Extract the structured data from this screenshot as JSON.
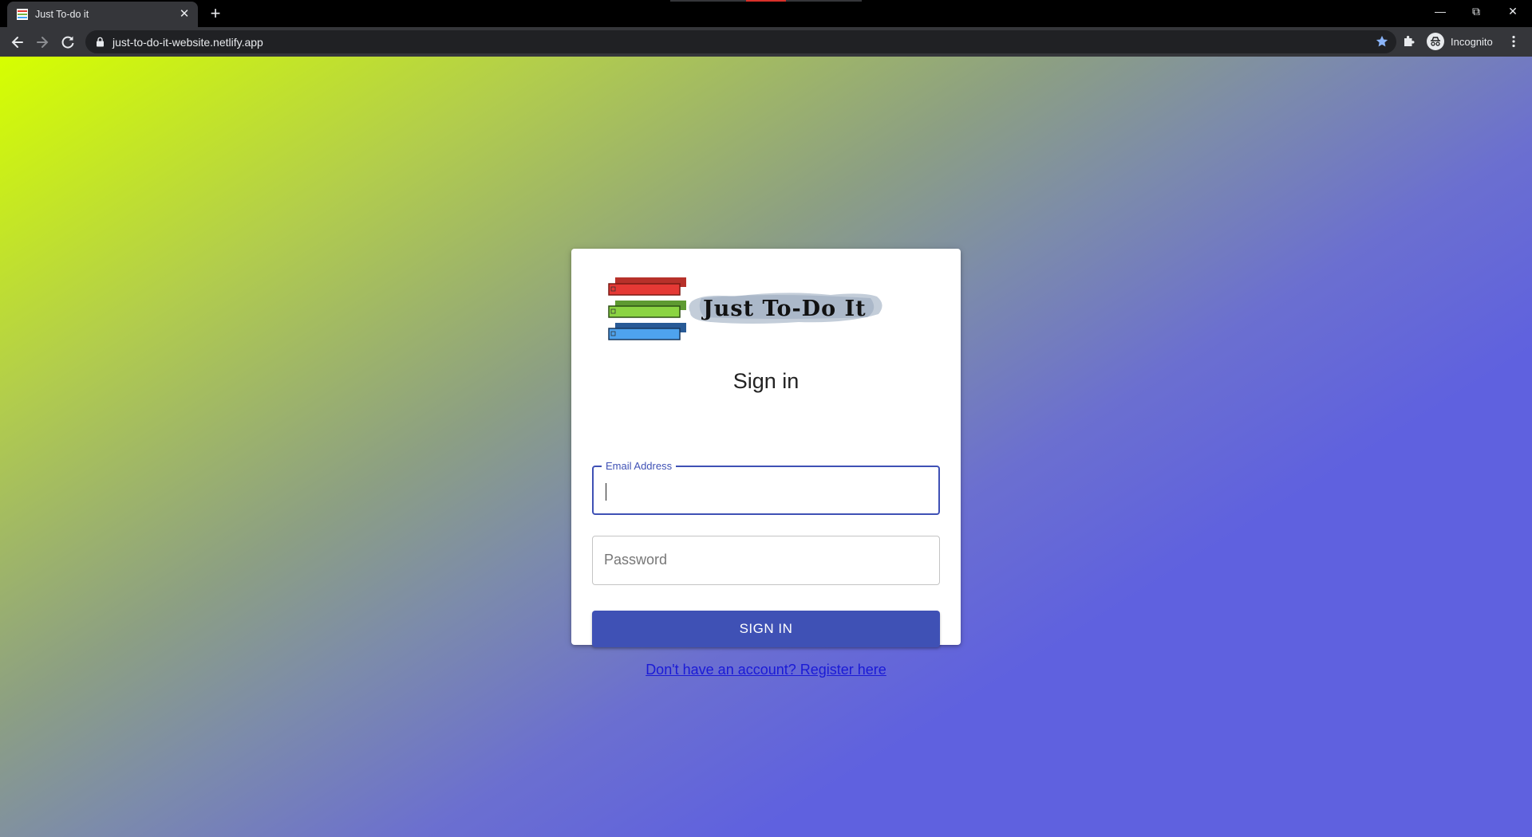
{
  "browser": {
    "tab_title": "Just To-do it",
    "url": "just-to-do-it-website.netlify.app",
    "profile_label": "Incognito",
    "accent_star": "#8ab4f8"
  },
  "icons": {
    "favicon": "striped-list-favicon",
    "tab_close": "close-icon",
    "new_tab": "plus-icon",
    "back": "arrow-back-icon",
    "forward": "arrow-forward-icon",
    "reload": "reload-icon",
    "lock": "lock-icon",
    "bookmark": "star-icon",
    "extensions": "puzzle-icon",
    "profile": "incognito-icon",
    "menu": "kebab-menu-icon"
  },
  "page": {
    "logo_text": "Just To-Do It",
    "heading": "Sign in",
    "email": {
      "label": "Email Address",
      "value": ""
    },
    "password": {
      "placeholder": "Password",
      "value": ""
    },
    "submit_label": "SIGN IN",
    "register_link": "Don't have an account? Register here",
    "colors": {
      "primary": "#3f51b5",
      "link": "#1a1ad6",
      "gradient_start": "#d6ff00",
      "gradient_end": "#5f61df"
    }
  }
}
